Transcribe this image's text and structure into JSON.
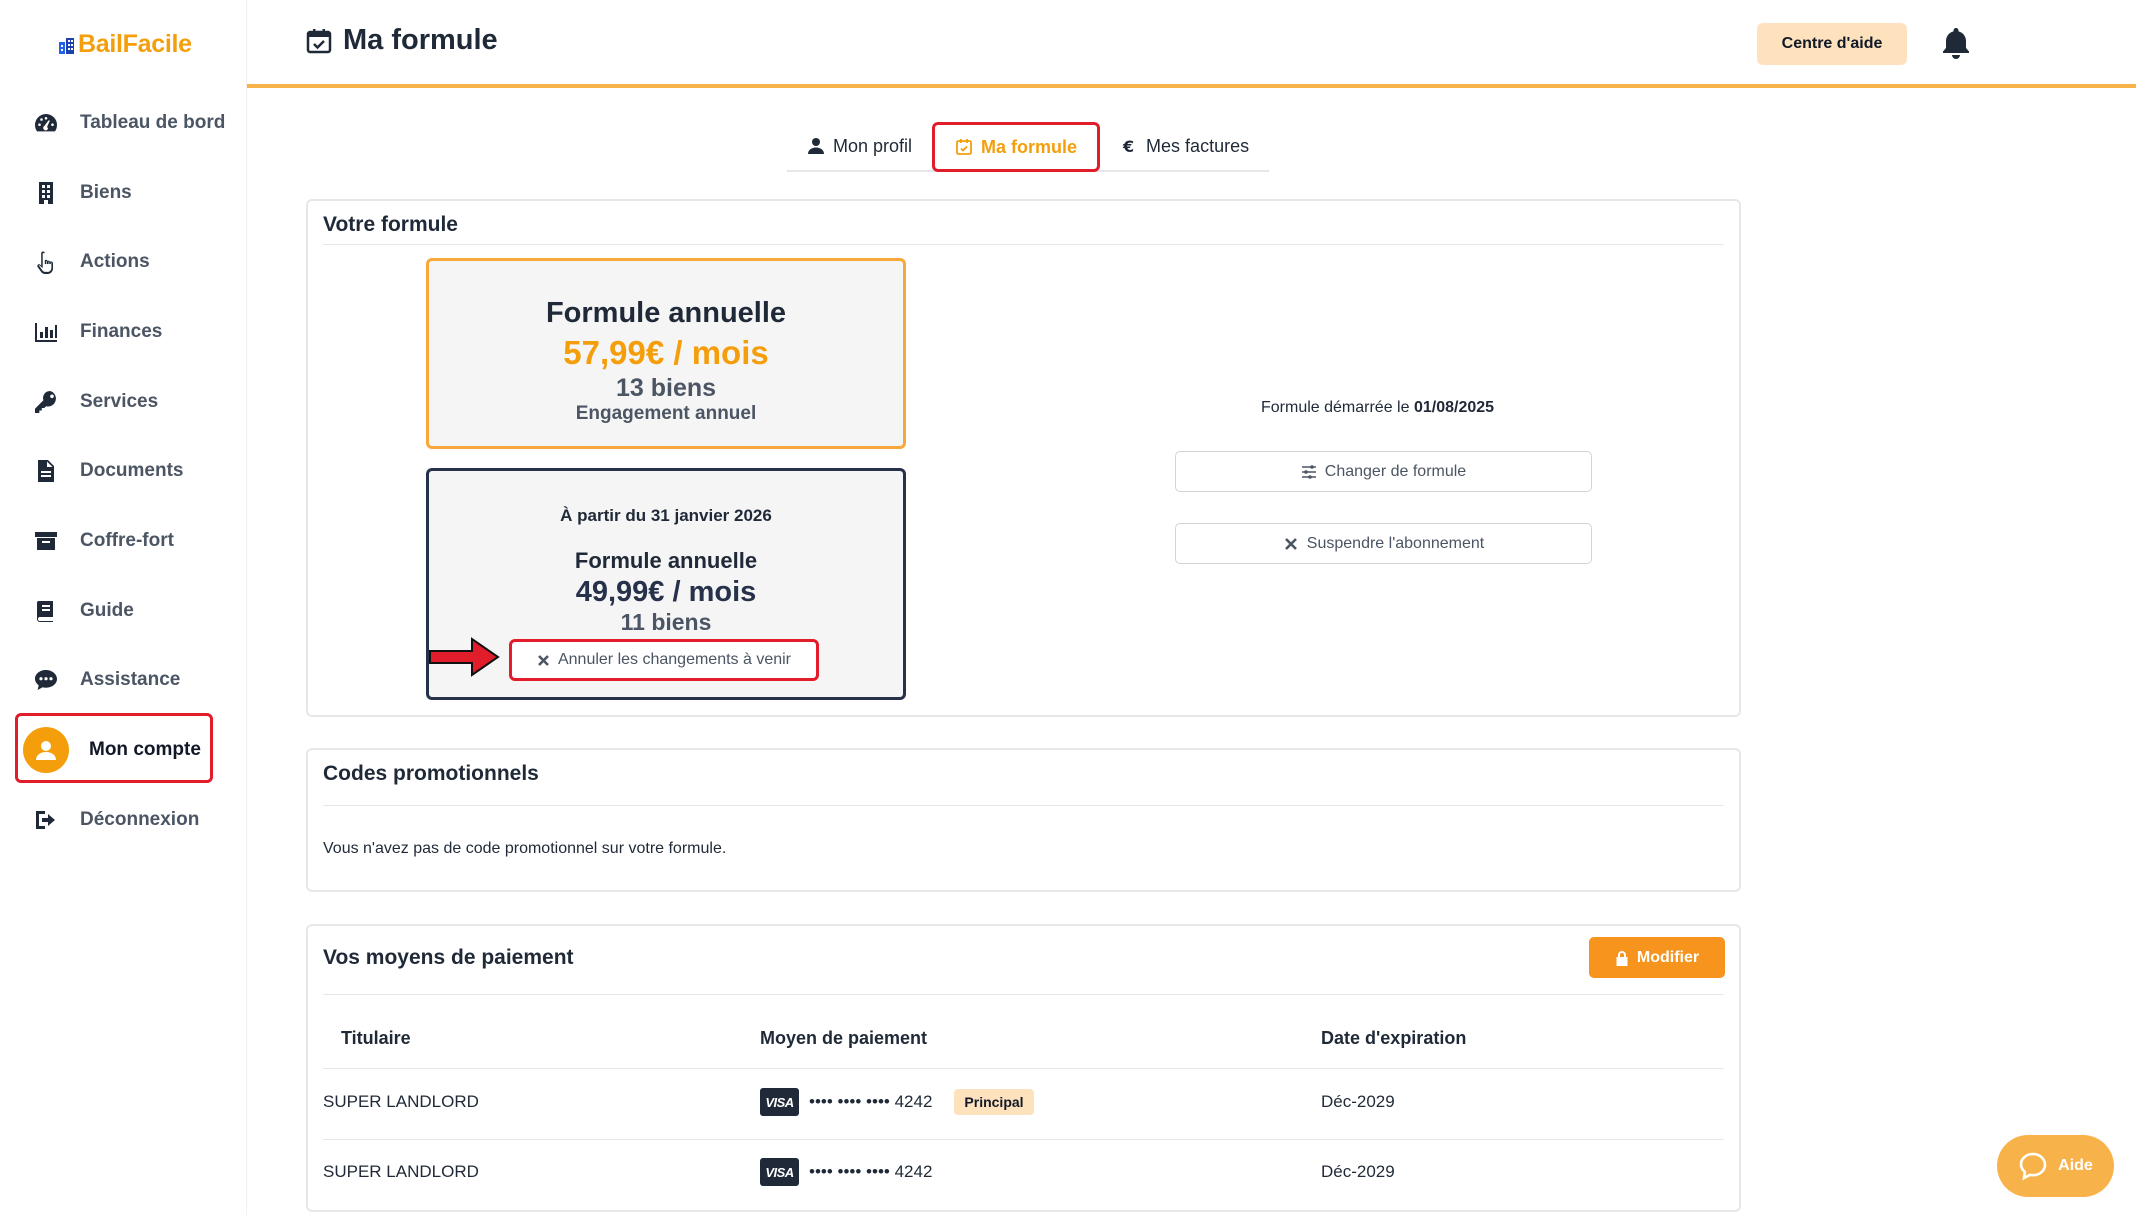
{
  "app": {
    "logo_text": "BailFacile"
  },
  "sidebar": {
    "items": [
      {
        "label": "Tableau de bord",
        "icon": "gauge-icon"
      },
      {
        "label": "Biens",
        "icon": "building-icon"
      },
      {
        "label": "Actions",
        "icon": "hand-pointer-icon"
      },
      {
        "label": "Finances",
        "icon": "bar-chart-icon"
      },
      {
        "label": "Services",
        "icon": "key-icon"
      },
      {
        "label": "Documents",
        "icon": "file-icon"
      },
      {
        "label": "Coffre-fort",
        "icon": "archive-icon"
      },
      {
        "label": "Guide",
        "icon": "book-icon"
      },
      {
        "label": "Assistance",
        "icon": "chat-icon"
      },
      {
        "label": "Mon compte",
        "icon": "user-avatar-icon"
      },
      {
        "label": "Déconnexion",
        "icon": "logout-icon"
      }
    ]
  },
  "header": {
    "title": "Ma formule",
    "help_label": "Centre d'aide"
  },
  "tabs": [
    {
      "label": "Mon profil"
    },
    {
      "label": "Ma formule"
    },
    {
      "label": "Mes factures"
    }
  ],
  "formule": {
    "section_title": "Votre formule",
    "current": {
      "title": "Formule annuelle",
      "price": "57,99€ / mois",
      "biens": "13 biens",
      "engagement": "Engagement annuel"
    },
    "upcoming": {
      "date_text": "À partir du 31 janvier 2026",
      "title": "Formule annuelle",
      "price": "49,99€ / mois",
      "biens": "11 biens",
      "cancel_label": "Annuler les changements à venir"
    },
    "started_prefix": "Formule démarrée le",
    "started_date": "01/08/2025",
    "change_label": "Changer de formule",
    "suspend_label": "Suspendre l'abonnement"
  },
  "promo": {
    "section_title": "Codes promotionnels",
    "text": "Vous n'avez pas de code promotionnel sur votre formule."
  },
  "payment": {
    "section_title": "Vos moyens de paiement",
    "modify_label": "Modifier",
    "columns": [
      "Titulaire",
      "Moyen de paiement",
      "Date d'expiration"
    ],
    "rows": [
      {
        "holder": "SUPER LANDLORD",
        "brand": "VISA",
        "number": "•••• •••• •••• 4242",
        "badge": "Principal",
        "expiry": "Déc-2029"
      },
      {
        "holder": "SUPER LANDLORD",
        "brand": "VISA",
        "number": "•••• •••• •••• 4242",
        "badge": "",
        "expiry": "Déc-2029"
      }
    ]
  },
  "fab": {
    "label": "Aide"
  },
  "colors": {
    "brand": "#f59e0b",
    "navy": "#27324a",
    "highlight": "#e11d2b"
  }
}
